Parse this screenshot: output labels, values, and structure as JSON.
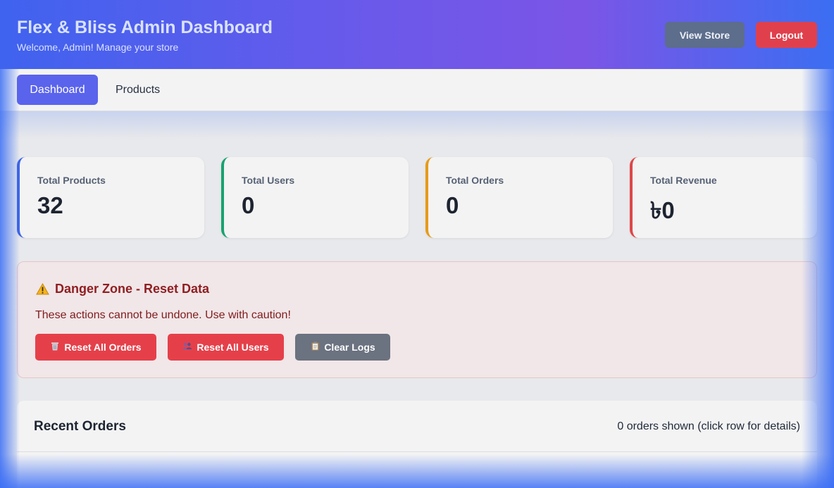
{
  "header": {
    "title": "Flex & Bliss Admin Dashboard",
    "subtitle": "Welcome, Admin! Manage your store",
    "view_store_label": "View Store",
    "logout_label": "Logout"
  },
  "nav": {
    "tabs": [
      {
        "label": "Dashboard",
        "active": true
      },
      {
        "label": "Products",
        "active": false
      }
    ]
  },
  "stats": [
    {
      "label": "Total Products",
      "value": "32",
      "accent": "#3d63e8"
    },
    {
      "label": "Total Users",
      "value": "0",
      "accent": "#17a36f"
    },
    {
      "label": "Total Orders",
      "value": "0",
      "accent": "#e69b16"
    },
    {
      "label": "Total Revenue",
      "value": "৳0",
      "accent": "#e04747"
    }
  ],
  "danger_zone": {
    "icon": "warning-icon",
    "title": "Danger Zone - Reset Data",
    "text": "These actions cannot be undone. Use with caution!",
    "buttons": [
      {
        "icon": "trash-icon",
        "label": "Reset All Orders"
      },
      {
        "icon": "users-icon",
        "label": "Reset All Users"
      },
      {
        "icon": "clipboard-icon",
        "label": "Clear Logs"
      }
    ]
  },
  "recent_orders": {
    "title": "Recent Orders",
    "count_text": "0 orders shown (click row for details)"
  }
}
